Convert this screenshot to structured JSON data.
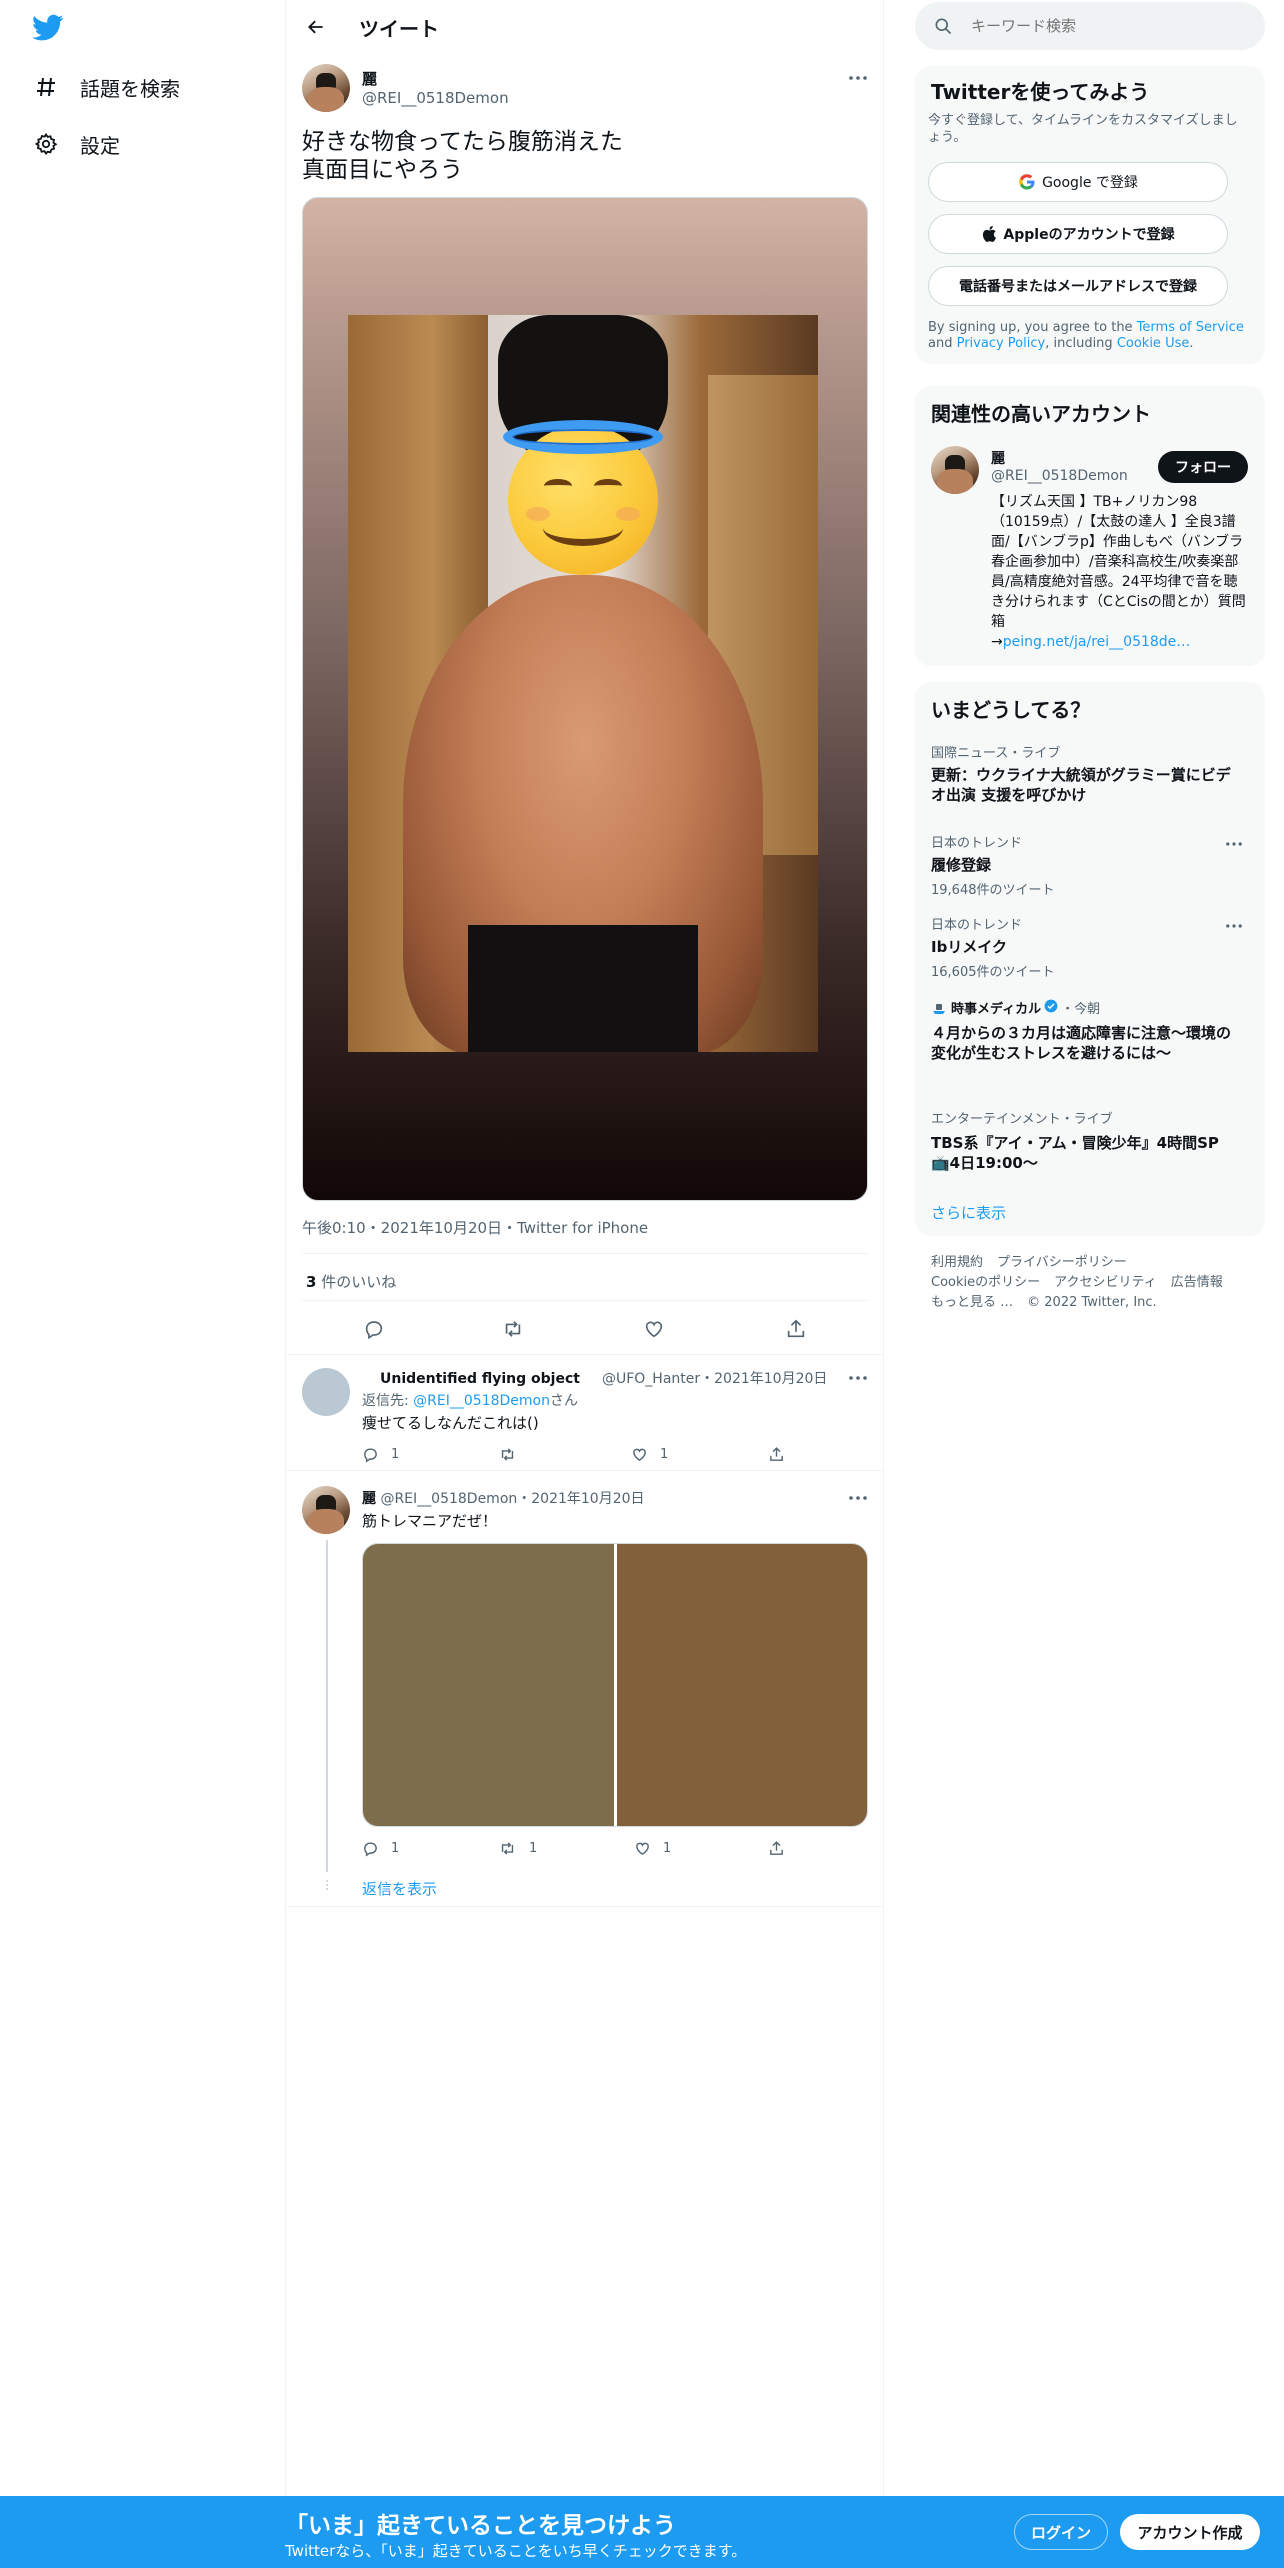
{
  "nav": {
    "explore": "話題を検索",
    "settings": "設定"
  },
  "header": {
    "title": "ツイート"
  },
  "tweet": {
    "name": "麗",
    "handle": "@REI__0518Demon",
    "text_line1": "好きな物食ってたら腹筋消えた",
    "text_line2": "真面目にやろう",
    "meta": "午後0:10・2021年10月20日・Twitter for iPhone",
    "likes_count": "3",
    "likes_label": " 件のいいね"
  },
  "reply1": {
    "name": "Unidentified flying object",
    "handle": "@UFO_Hanter",
    "date": "・2021年10月20日",
    "reply_to_prefix": "返信先: ",
    "reply_to_handle": "@REI__0518Demon",
    "reply_to_suffix": "さん",
    "text": "痩せてるしなんだこれは()",
    "replies": "1",
    "likes": "1"
  },
  "reply2": {
    "name": "麗",
    "handle": "@REI__0518Demon",
    "date": "・2021年10月20日",
    "text": "筋トレマニアだぜ！",
    "replies": "1",
    "retweets": "1",
    "likes": "1",
    "show_replies": "返信を表示",
    "media_colors": [
      "#7d6d4a",
      "#82603c"
    ]
  },
  "search": {
    "placeholder": "キーワード検索"
  },
  "signup_card": {
    "title": "Twitterを使ってみよう",
    "subtitle": "今すぐ登録して、タイムラインをカスタマイズしましょう。",
    "google": "Google で登録",
    "apple": "Appleのアカウントで登録",
    "phone": "電話番号またはメールアドレスで登録",
    "terms_prefix": "By signing up, you agree to the ",
    "terms_link": "Terms of Service",
    "terms_mid": " and ",
    "privacy_link": "Privacy Policy",
    "terms_mid2": ", including ",
    "cookie_link": "Cookie Use",
    "terms_end": "."
  },
  "related_card": {
    "title": "関連性の高いアカウント",
    "name": "麗",
    "handle": "@REI__0518Demon",
    "follow": "フォロー",
    "bio": "【リズム天国 】TB+ノリカン98（10159点）/【太鼓の達人 】全良3譜面/【バンブラp】作曲しもべ（バンブラ春企画参加中）/音楽科高校生/吹奏楽部員/高精度絶対音感。24平均律で音を聴き分けられます（CとCisの間とか）質問箱",
    "bio_link_prefix": "→",
    "bio_link": "peing.net/ja/rei__0518de…"
  },
  "trends_card": {
    "title": "いまどうしてる？",
    "items": [
      {
        "category": "国際ニュース・ライブ",
        "name": "更新：ウクライナ大統領がグラミー賞にビデオ出演 支援を呼びかけ",
        "count": ""
      },
      {
        "category": "日本のトレンド",
        "name": "履修登録",
        "count": "19,648件のツイート"
      },
      {
        "category": "日本のトレンド",
        "name": "Ibリメイク",
        "count": "16,605件のツイート"
      },
      {
        "category": "時事メディカル",
        "category_suffix": "・今朝",
        "name": "４月からの３カ月は適応障害に注意～環境の変化が生むストレスを避けるには～",
        "count": ""
      },
      {
        "category": "エンターテインメント・ライブ",
        "name": "TBS系『アイ・アム・冒険少年』4時間SP📺4日19:00〜",
        "count": ""
      }
    ],
    "show_more": "さらに表示"
  },
  "footer": {
    "links": [
      "利用規約",
      "プライバシーポリシー",
      "Cookieのポリシー",
      "アクセシビリティ",
      "広告情報",
      "もっと見る …"
    ],
    "copyright": "© 2022 Twitter, Inc."
  },
  "bottom_bar": {
    "title": "「いま」起きていることを見つけよう",
    "subtitle": "Twitterなら、「いま」起きていることをいち早くチェックできます。",
    "login": "ログイン",
    "signup": "アカウント作成"
  },
  "colors": {
    "accent": "#1d9bf0",
    "text": "#0f1419",
    "muted": "#536471",
    "verified": "#1d9bf0"
  }
}
